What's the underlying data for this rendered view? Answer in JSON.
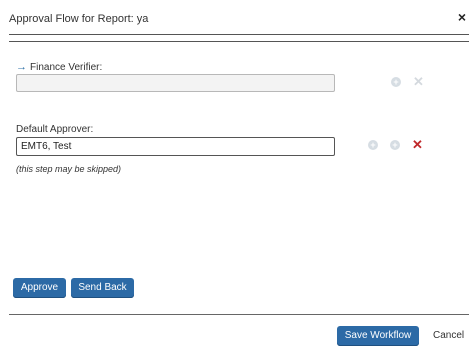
{
  "dialog": {
    "title": "Approval Flow for Report: ya",
    "close_glyph": "×"
  },
  "steps": [
    {
      "label": "Finance Verifier:",
      "value": "",
      "icons": [
        "add-icon-disabled",
        "remove-icon-disabled"
      ]
    },
    {
      "label": "Default Approver:",
      "value": "EMT6, Test",
      "note": "(this step may be skipped)",
      "icons": [
        "add-above-icon-disabled",
        "add-below-icon-disabled",
        "remove-icon"
      ]
    }
  ],
  "buttons": {
    "approve": "Approve",
    "send_back": "Send Back",
    "save_workflow": "Save Workflow",
    "cancel": "Cancel"
  },
  "colors": {
    "primary_button": "#2c6aa6",
    "remove_icon": "#c0282a",
    "arrow": "#2a6ea6"
  }
}
